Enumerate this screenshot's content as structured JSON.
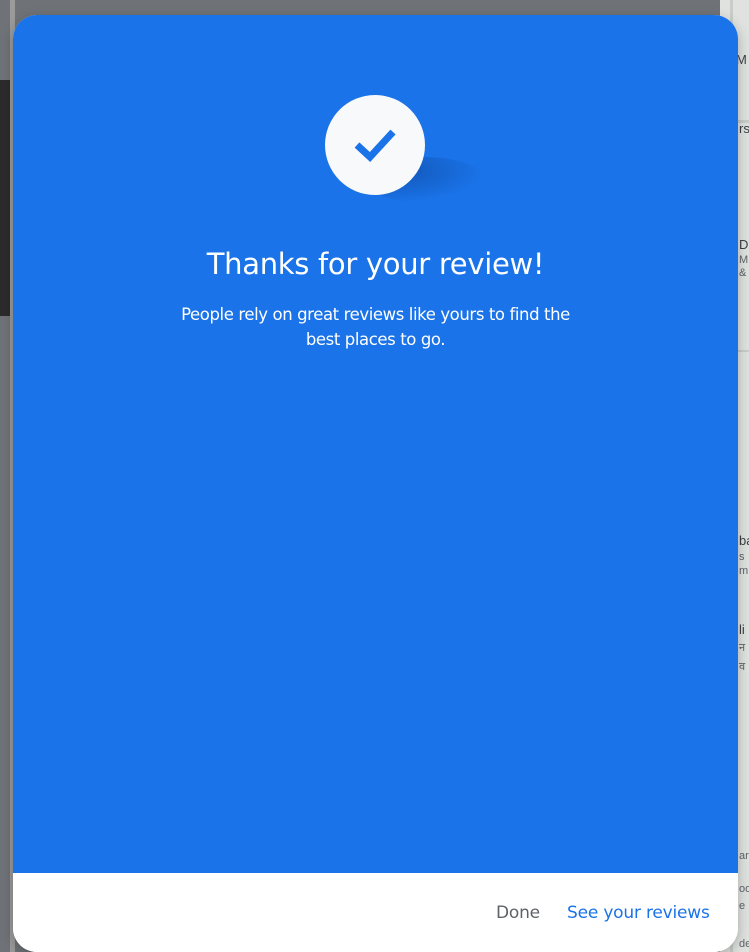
{
  "background_map": {
    "fragments": [
      "r M",
      "rs",
      "D",
      "M",
      "&",
      "ba",
      "s",
      "m",
      "li",
      "न",
      "व",
      "ar",
      "oo",
      "e",
      "de"
    ]
  },
  "dialog": {
    "icon": "check-icon",
    "title": "Thanks for your review!",
    "subtitle": "People rely on great reviews like yours to find the best places to go.",
    "buttons": {
      "done": "Done",
      "see_reviews": "See your reviews"
    }
  },
  "colors": {
    "hero_blue": "#1a73e8",
    "primary_text_button": "#1a73e8",
    "secondary_text_button": "#5f6368",
    "check_circle": "#f8f9fa"
  }
}
